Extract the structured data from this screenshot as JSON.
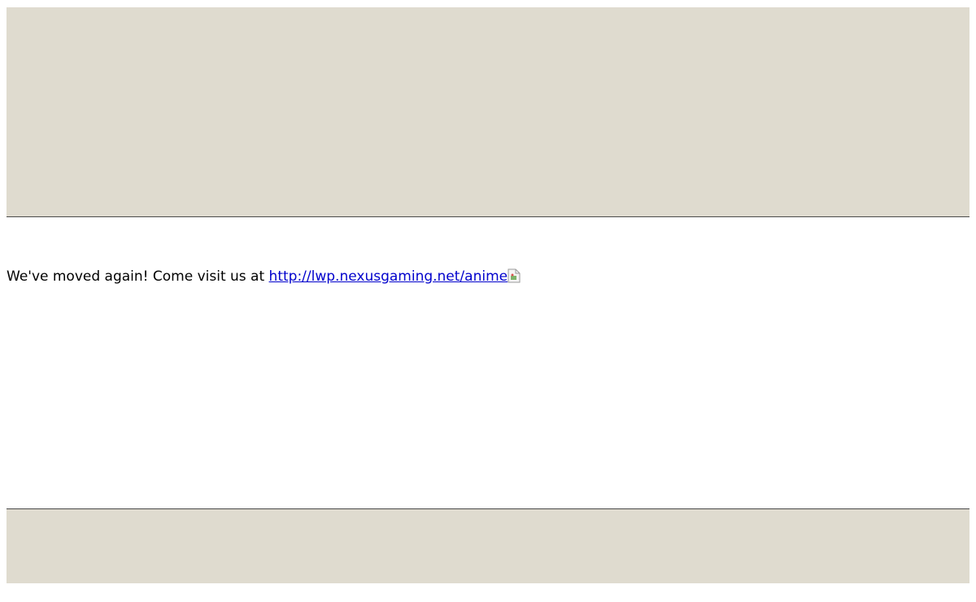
{
  "colors": {
    "band_background": "#dfdbcf",
    "band_border": "#4a4a4a",
    "link": "#0000cc",
    "text": "#000000"
  },
  "content": {
    "message": "We've moved again! Come visit us at ",
    "link_text": "http://lwp.nexusgaming.net/anime",
    "image_icon": "broken-image-icon"
  }
}
